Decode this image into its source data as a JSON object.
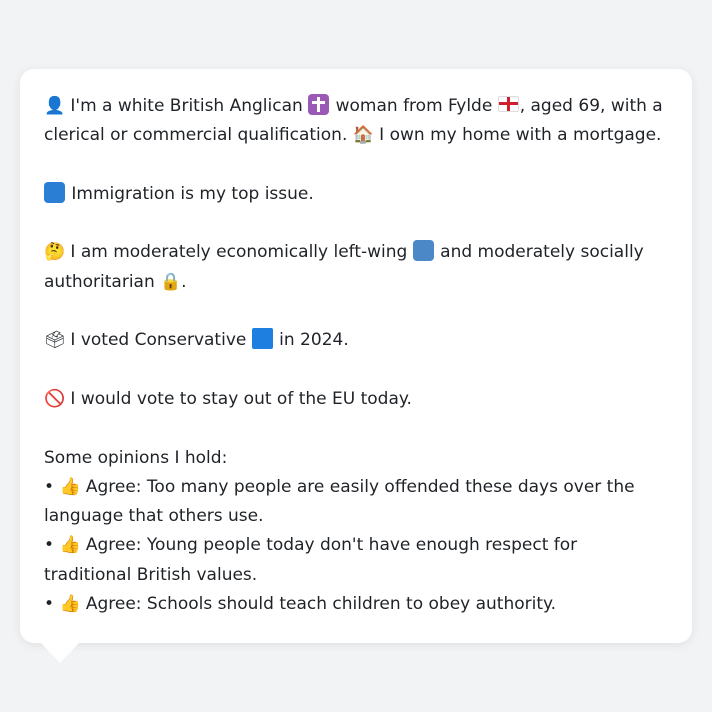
{
  "message": {
    "intro_line": "I'm a white British Anglican",
    "intro_cont": "woman from Fylde",
    "intro_end": ", aged 69, with a clerical or commercial qualification.",
    "home_line": "I own my home with a mortgage.",
    "top_issue": "Immigration is my top issue.",
    "econ_a": "I am moderately economically left-wing",
    "econ_b": "and moderately socially authoritarian",
    "econ_end": ".",
    "vote_a": "I voted Conservative",
    "vote_b": "in 2024.",
    "eu": "I would vote to stay out of the EU today.",
    "opinions_header": "Some opinions I hold:",
    "opinions": [
      "Agree: Too many people are easily offended these days over the language that others use.",
      "Agree: Young people today don't have enough respect for traditional British values.",
      "Agree: Schools should teach children to obey authority."
    ],
    "bullet": "•"
  },
  "icons": {
    "person": "bust-silhouette-icon",
    "religion": "latin-cross-icon",
    "region": "england-flag-icon",
    "home": "house-icon",
    "issue": "passport-control-icon",
    "thinking": "thinking-face-icon",
    "left": "left-arrow-icon",
    "authoritarian": "lock-icon",
    "ballot": "ballot-box-icon",
    "party": "blue-square-icon",
    "prohibited": "prohibited-icon",
    "agree": "thumbs-up-icon"
  },
  "colors": {
    "page_background": "#f1f3f5",
    "card_background": "#ffffff",
    "text": "#1f2328",
    "party_blue": "#1f7fe0"
  }
}
